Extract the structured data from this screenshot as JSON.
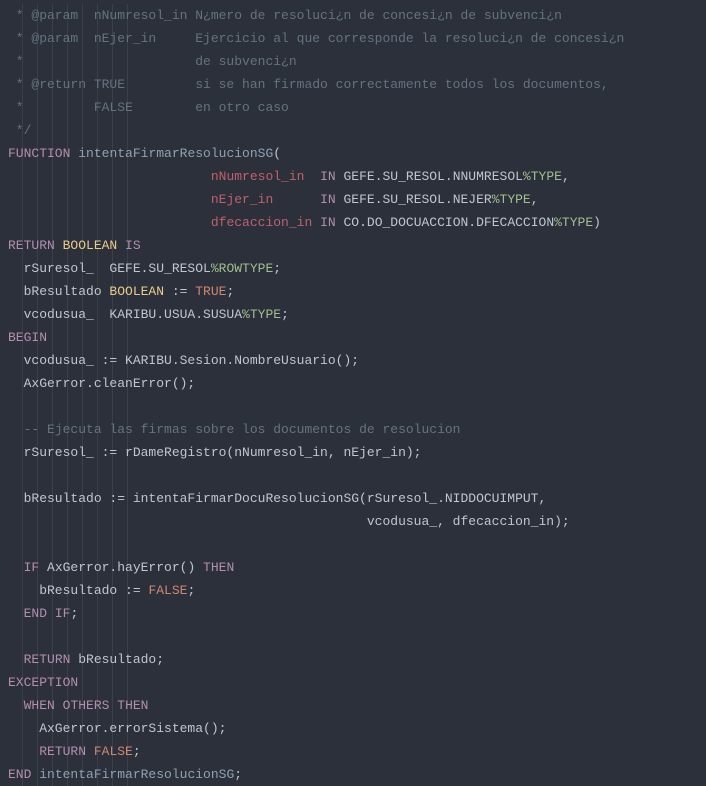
{
  "code": {
    "lines": [
      {
        "segments": [
          {
            "cls": "comment",
            "text": " * @param  nNumresol_in N¿mero de resoluci¿n de concesi¿n de subvenci¿n"
          }
        ]
      },
      {
        "segments": [
          {
            "cls": "comment",
            "text": " * @param  nEjer_in     Ejercicio al que corresponde la resoluci¿n de concesi¿n"
          }
        ]
      },
      {
        "segments": [
          {
            "cls": "comment",
            "text": " *                      de subvenci¿n"
          }
        ]
      },
      {
        "segments": [
          {
            "cls": "comment",
            "text": " * @return TRUE         si se han firmado correctamente todos los documentos,"
          }
        ]
      },
      {
        "segments": [
          {
            "cls": "comment",
            "text": " *         FALSE        en otro caso"
          }
        ]
      },
      {
        "segments": [
          {
            "cls": "comment",
            "text": " */"
          }
        ]
      },
      {
        "segments": [
          {
            "cls": "keyword",
            "text": "FUNCTION"
          },
          {
            "cls": "identifier",
            "text": " "
          },
          {
            "cls": "func",
            "text": "intentaFirmarResolucionSG"
          },
          {
            "cls": "punct",
            "text": "("
          }
        ]
      },
      {
        "segments": [
          {
            "cls": "identifier",
            "text": "                          "
          },
          {
            "cls": "param",
            "text": "nNumresol_in "
          },
          {
            "cls": "identifier",
            "text": " "
          },
          {
            "cls": "keyword",
            "text": "IN"
          },
          {
            "cls": "identifier",
            "text": " GEFE.SU_RESOL.NNUMRESOL"
          },
          {
            "cls": "typepart",
            "text": "%TYPE"
          },
          {
            "cls": "punct",
            "text": ","
          }
        ]
      },
      {
        "segments": [
          {
            "cls": "identifier",
            "text": "                          "
          },
          {
            "cls": "param",
            "text": "nEjer_in     "
          },
          {
            "cls": "identifier",
            "text": " "
          },
          {
            "cls": "keyword",
            "text": "IN"
          },
          {
            "cls": "identifier",
            "text": " GEFE.SU_RESOL.NEJER"
          },
          {
            "cls": "typepart",
            "text": "%TYPE"
          },
          {
            "cls": "punct",
            "text": ","
          }
        ]
      },
      {
        "segments": [
          {
            "cls": "identifier",
            "text": "                          "
          },
          {
            "cls": "param",
            "text": "dfecaccion_in"
          },
          {
            "cls": "identifier",
            "text": " "
          },
          {
            "cls": "keyword",
            "text": "IN"
          },
          {
            "cls": "identifier",
            "text": " CO.DO_DOCUACCION.DFECACCION"
          },
          {
            "cls": "typepart",
            "text": "%TYPE"
          },
          {
            "cls": "punct",
            "text": ")"
          }
        ]
      },
      {
        "segments": [
          {
            "cls": "keyword",
            "text": "RETURN"
          },
          {
            "cls": "identifier",
            "text": " "
          },
          {
            "cls": "type",
            "text": "BOOLEAN"
          },
          {
            "cls": "identifier",
            "text": " "
          },
          {
            "cls": "keyword",
            "text": "IS"
          }
        ]
      },
      {
        "segments": [
          {
            "cls": "identifier",
            "text": "  rSuresol_  GEFE.SU_RESOL"
          },
          {
            "cls": "typepart",
            "text": "%ROWTYPE"
          },
          {
            "cls": "punct",
            "text": ";"
          }
        ]
      },
      {
        "segments": [
          {
            "cls": "identifier",
            "text": "  bResultado "
          },
          {
            "cls": "type",
            "text": "BOOLEAN"
          },
          {
            "cls": "identifier",
            "text": " := "
          },
          {
            "cls": "const",
            "text": "TRUE"
          },
          {
            "cls": "punct",
            "text": ";"
          }
        ]
      },
      {
        "segments": [
          {
            "cls": "identifier",
            "text": "  vcodusua_  KARIBU.USUA.SUSUA"
          },
          {
            "cls": "typepart",
            "text": "%TYPE"
          },
          {
            "cls": "punct",
            "text": ";"
          }
        ]
      },
      {
        "segments": [
          {
            "cls": "keyword",
            "text": "BEGIN"
          }
        ]
      },
      {
        "segments": [
          {
            "cls": "identifier",
            "text": "  vcodusua_ := KARIBU.Sesion.NombreUsuario();"
          }
        ]
      },
      {
        "segments": [
          {
            "cls": "identifier",
            "text": "  AxGerror.cleanError();"
          }
        ]
      },
      {
        "segments": [
          {
            "cls": "identifier",
            "text": ""
          }
        ]
      },
      {
        "segments": [
          {
            "cls": "identifier",
            "text": "  "
          },
          {
            "cls": "comment",
            "text": "-- Ejecuta las firmas sobre los documentos de resolucion"
          }
        ]
      },
      {
        "segments": [
          {
            "cls": "identifier",
            "text": "  rSuresol_ := rDameRegistro(nNumresol_in, nEjer_in);"
          }
        ]
      },
      {
        "segments": [
          {
            "cls": "identifier",
            "text": ""
          }
        ]
      },
      {
        "segments": [
          {
            "cls": "identifier",
            "text": "  bResultado := intentaFirmarDocuResolucionSG(rSuresol_.NIDDOCUIMPUT,"
          }
        ]
      },
      {
        "segments": [
          {
            "cls": "identifier",
            "text": "                                              vcodusua_, dfecaccion_in);"
          }
        ]
      },
      {
        "segments": [
          {
            "cls": "identifier",
            "text": ""
          }
        ]
      },
      {
        "segments": [
          {
            "cls": "identifier",
            "text": "  "
          },
          {
            "cls": "keyword",
            "text": "IF"
          },
          {
            "cls": "identifier",
            "text": " AxGerror.hayError() "
          },
          {
            "cls": "keyword",
            "text": "THEN"
          }
        ]
      },
      {
        "segments": [
          {
            "cls": "identifier",
            "text": "    bResultado := "
          },
          {
            "cls": "const",
            "text": "FALSE"
          },
          {
            "cls": "punct",
            "text": ";"
          }
        ]
      },
      {
        "segments": [
          {
            "cls": "identifier",
            "text": "  "
          },
          {
            "cls": "keyword",
            "text": "END"
          },
          {
            "cls": "identifier",
            "text": " "
          },
          {
            "cls": "keyword",
            "text": "IF"
          },
          {
            "cls": "punct",
            "text": ";"
          }
        ]
      },
      {
        "segments": [
          {
            "cls": "identifier",
            "text": ""
          }
        ]
      },
      {
        "segments": [
          {
            "cls": "identifier",
            "text": "  "
          },
          {
            "cls": "keyword",
            "text": "RETURN"
          },
          {
            "cls": "identifier",
            "text": " bResultado;"
          }
        ]
      },
      {
        "segments": [
          {
            "cls": "keyword",
            "text": "EXCEPTION"
          }
        ]
      },
      {
        "segments": [
          {
            "cls": "identifier",
            "text": "  "
          },
          {
            "cls": "keyword",
            "text": "WHEN"
          },
          {
            "cls": "identifier",
            "text": " "
          },
          {
            "cls": "keyword",
            "text": "OTHERS"
          },
          {
            "cls": "identifier",
            "text": " "
          },
          {
            "cls": "keyword",
            "text": "THEN"
          }
        ]
      },
      {
        "segments": [
          {
            "cls": "identifier",
            "text": "    AxGerror.errorSistema();"
          }
        ]
      },
      {
        "segments": [
          {
            "cls": "identifier",
            "text": "    "
          },
          {
            "cls": "keyword",
            "text": "RETURN"
          },
          {
            "cls": "identifier",
            "text": " "
          },
          {
            "cls": "const",
            "text": "FALSE"
          },
          {
            "cls": "punct",
            "text": ";"
          }
        ]
      },
      {
        "segments": [
          {
            "cls": "keyword",
            "text": "END"
          },
          {
            "cls": "identifier",
            "text": " "
          },
          {
            "cls": "func",
            "text": "intentaFirmarResolucionSG"
          },
          {
            "cls": "punct",
            "text": ";"
          }
        ]
      }
    ],
    "indent_guides": [
      22,
      37,
      52,
      67,
      82,
      97,
      112,
      127
    ]
  }
}
